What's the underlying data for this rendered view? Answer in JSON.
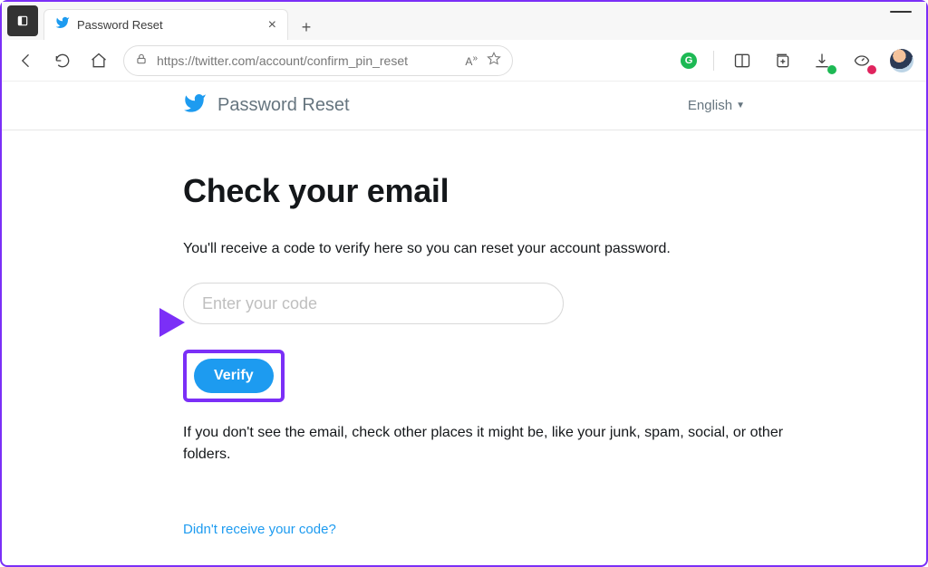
{
  "browser": {
    "tab_title": "Password Reset",
    "url": "https://twitter.com/account/confirm_pin_reset"
  },
  "header": {
    "page_title": "Password Reset",
    "language": "English"
  },
  "main": {
    "heading": "Check your email",
    "subtext": "You'll receive a code to verify here so you can reset your account password.",
    "code_placeholder": "Enter your code",
    "verify_label": "Verify",
    "hint": "If you don't see the email, check other places it might be, like your junk, spam, social, or other folders.",
    "resend_link": "Didn't receive your code?"
  }
}
